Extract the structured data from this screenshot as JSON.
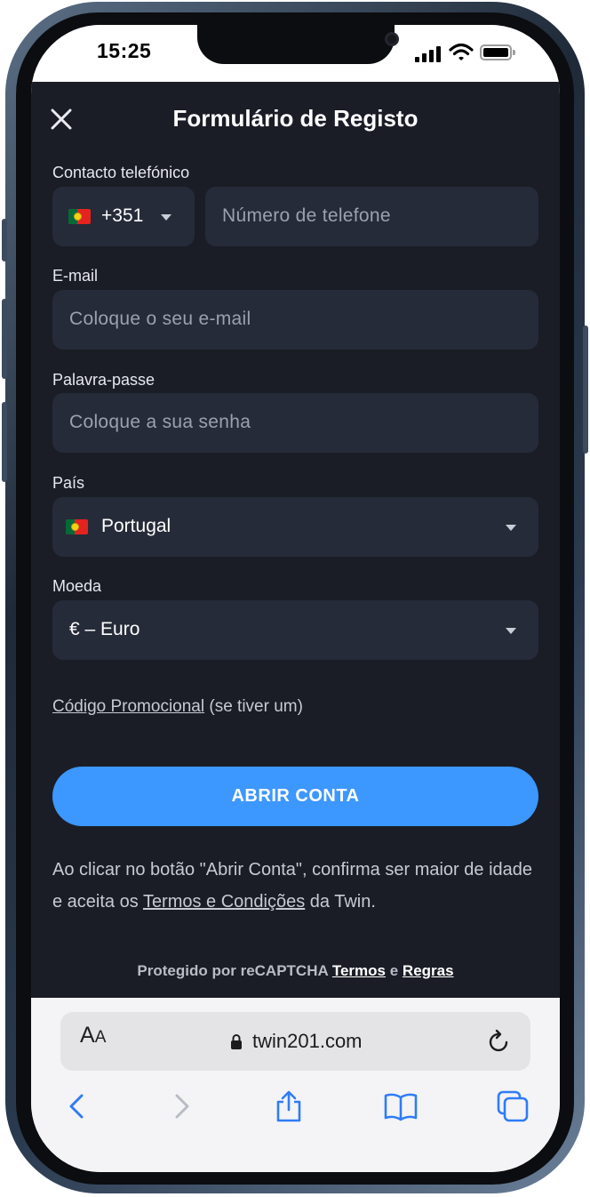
{
  "status_bar": {
    "time": "15:25"
  },
  "form": {
    "title": "Formulário de Registo",
    "phone": {
      "label": "Contacto telefónico",
      "country_code": "+351",
      "placeholder": "Número de telefone"
    },
    "email": {
      "label": "E-mail",
      "placeholder": "Coloque o seu e-mail"
    },
    "password": {
      "label": "Palavra-passe",
      "placeholder": "Coloque a sua senha"
    },
    "country": {
      "label": "País",
      "value": "Portugal"
    },
    "currency": {
      "label": "Moeda",
      "value": "€ – Euro"
    },
    "promo": {
      "link": "Código Promocional",
      "suffix": " (se tiver um)"
    },
    "submit_label": "ABRIR CONTA",
    "disclaimer": {
      "before": "Ao clicar no botão \"Abrir Conta\", confirma ser maior de idade e aceita os ",
      "link": "Termos e Condições",
      "after": " da Twin."
    },
    "recaptcha": {
      "prefix": "Protegido por reCAPTCHA ",
      "terms": "Termos",
      "and": " e ",
      "rules": "Regras"
    }
  },
  "browser": {
    "aa_big": "A",
    "aa_small": "A",
    "url": "twin201.com",
    "icons": [
      "back-icon",
      "forward-icon",
      "share-icon",
      "bookmarks-icon",
      "tabs-icon",
      "reload-icon",
      "lock-icon"
    ]
  },
  "colors": {
    "app_bg": "#1a1d26",
    "field_bg": "#262b39",
    "accent": "#3c97ff"
  }
}
